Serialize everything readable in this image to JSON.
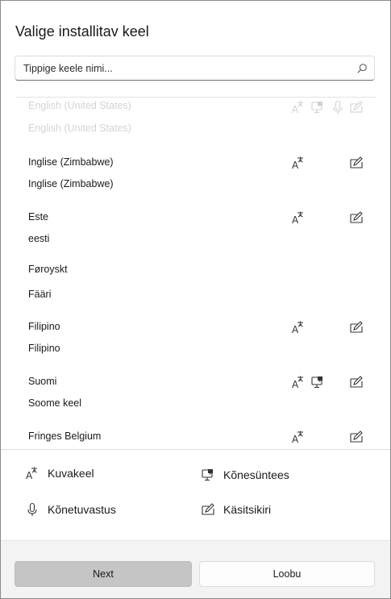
{
  "dialog": {
    "title": "Valige installitav keel"
  },
  "search": {
    "placeholder": "Tippige keele nimi..."
  },
  "languages": [
    {
      "name": "English (United States)",
      "native": "English (United States)",
      "features": [
        "display",
        "speech",
        "recognition",
        "handwriting"
      ],
      "faded": true
    },
    {
      "name": "Inglise (Zimbabwe)",
      "native": "Inglise (Zimbabwe)",
      "features": [
        "display",
        "handwriting"
      ],
      "faded": false
    },
    {
      "name": "Este",
      "native": "eesti",
      "features": [
        "display",
        "handwriting"
      ],
      "faded": false
    },
    {
      "name": "Føroyskt",
      "native": "Fääri",
      "features": [],
      "faded": false
    },
    {
      "name": "Filipino",
      "native": "Filipino",
      "features": [
        "display",
        "handwriting"
      ],
      "faded": false
    },
    {
      "name": "Suomi",
      "native": "Soome keel",
      "features": [
        "display",
        "speech",
        "handwriting"
      ],
      "faded": false
    },
    {
      "name": "Fringes Belgium",
      "native": "",
      "features": [
        "display",
        "handwriting"
      ],
      "faded": false
    }
  ],
  "legend": {
    "display": "Kuvakeel",
    "speech": "Kõnesüntees",
    "recognition": "Kõnetuvastus",
    "handwriting": "Käsitsikiri"
  },
  "buttons": {
    "next": "Next",
    "cancel": "Loobu"
  },
  "icons": {
    "display": "display-language-icon",
    "speech": "text-to-speech-icon",
    "recognition": "microphone-icon",
    "handwriting": "handwriting-icon",
    "search": "search-icon"
  }
}
